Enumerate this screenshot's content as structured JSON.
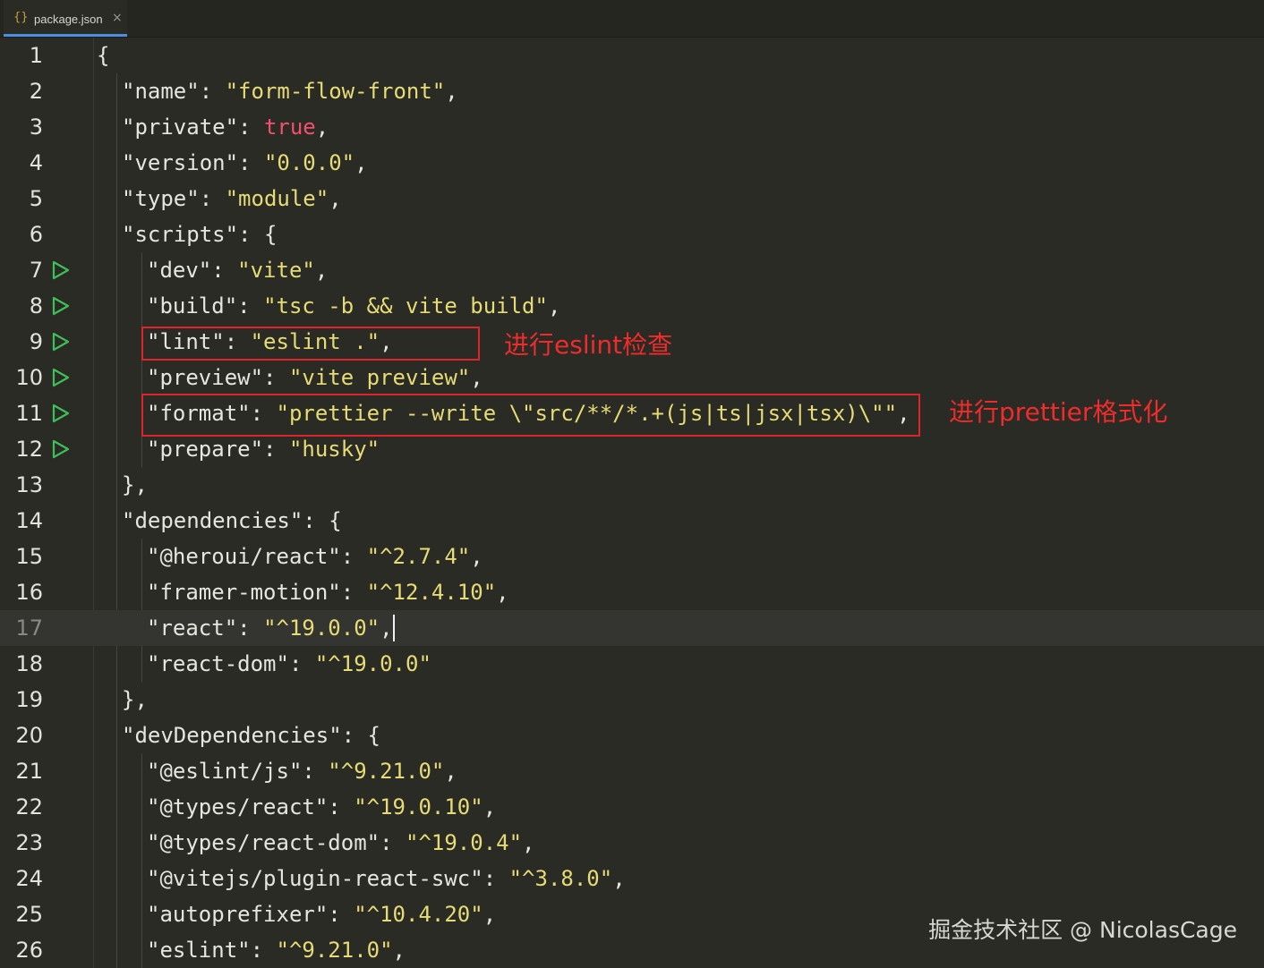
{
  "tab": {
    "label": "package.json",
    "icon": "json-braces-icon",
    "close": "×"
  },
  "annotations": {
    "lint_note": "进行eslint检查",
    "format_note": "进行prettier格式化"
  },
  "watermark": "掘金技术社区 @ NicolasCage",
  "current_line": 17,
  "lines": [
    {
      "n": "1"
    },
    {
      "n": "2"
    },
    {
      "n": "3"
    },
    {
      "n": "4"
    },
    {
      "n": "5"
    },
    {
      "n": "6"
    },
    {
      "n": "7"
    },
    {
      "n": "8"
    },
    {
      "n": "9"
    },
    {
      "n": "10"
    },
    {
      "n": "11"
    },
    {
      "n": "12"
    },
    {
      "n": "13"
    },
    {
      "n": "14"
    },
    {
      "n": "15"
    },
    {
      "n": "16"
    },
    {
      "n": "17"
    },
    {
      "n": "18"
    },
    {
      "n": "19"
    },
    {
      "n": "20"
    },
    {
      "n": "21"
    },
    {
      "n": "22"
    },
    {
      "n": "23"
    },
    {
      "n": "24"
    },
    {
      "n": "25"
    },
    {
      "n": "26"
    }
  ],
  "code": {
    "l1": "{",
    "l2_key": "\"name\"",
    "l2_val": "\"form-flow-front\"",
    "l3_key": "\"private\"",
    "l3_val": "true",
    "l4_key": "\"version\"",
    "l4_val": "\"0.0.0\"",
    "l5_key": "\"type\"",
    "l5_val": "\"module\"",
    "l6_key": "\"scripts\"",
    "l7_key": "\"dev\"",
    "l7_val": "\"vite\"",
    "l8_key": "\"build\"",
    "l8_val": "\"tsc -b && vite build\"",
    "l9_key": "\"lint\"",
    "l9_val": "\"eslint .\"",
    "l10_key": "\"preview\"",
    "l10_val": "\"vite preview\"",
    "l11_key": "\"format\"",
    "l11_val": "\"prettier --write \\\"src/**/*.+(js|ts|jsx|tsx)\\\"\"",
    "l12_key": "\"prepare\"",
    "l12_val": "\"husky\"",
    "l13": "},",
    "l14_key": "\"dependencies\"",
    "l15_key": "\"@heroui/react\"",
    "l15_val": "\"^2.7.4\"",
    "l16_key": "\"framer-motion\"",
    "l16_val": "\"^12.4.10\"",
    "l17_key": "\"react\"",
    "l17_val": "\"^19.0.0\"",
    "l18_key": "\"react-dom\"",
    "l18_val": "\"^19.0.0\"",
    "l19": "},",
    "l20_key": "\"devDependencies\"",
    "l21_key": "\"@eslint/js\"",
    "l21_val": "\"^9.21.0\"",
    "l22_key": "\"@types/react\"",
    "l22_val": "\"^19.0.10\"",
    "l23_key": "\"@types/react-dom\"",
    "l23_val": "\"^19.0.4\"",
    "l24_key": "\"@vitejs/plugin-react-swc\"",
    "l24_val": "\"^3.8.0\"",
    "l25_key": "\"autoprefixer\"",
    "l25_val": "\"^10.4.20\"",
    "l26_key": "\"eslint\"",
    "l26_val": "\"^9.21.0\""
  },
  "colors": {
    "background": "#2a2b25",
    "string": "#e6db74",
    "boolean": "#f2506e",
    "annotation": "#e0242b",
    "run_icon": "#3fbf5a",
    "tab_accent": "#4a8fe0"
  }
}
